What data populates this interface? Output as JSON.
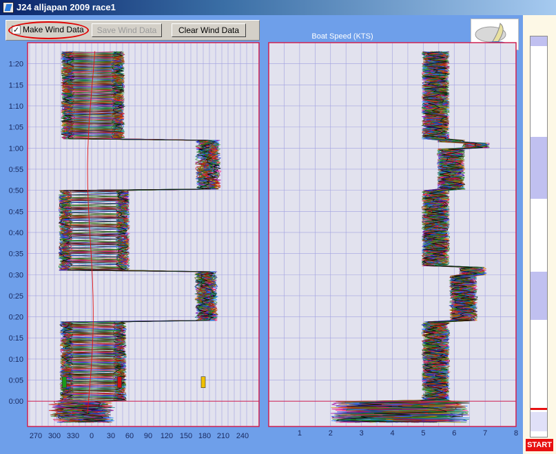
{
  "window": {
    "title": "J24  alljapan 2009 race1"
  },
  "toolbar": {
    "make_wind_label": "Make Wind Data",
    "make_wind_checked": "✓",
    "save_wind_label": "Save Wind Data",
    "clear_wind_label": "Clear Wind Data"
  },
  "colors": {
    "frame": "#6e9fea",
    "plot_bg": "#e2e2ee",
    "grid": "#a0a0e0",
    "axis_border": "#d02050",
    "start_red": "#e81010"
  },
  "sidebar": {
    "start_label": "START"
  },
  "chart_data": [
    {
      "type": "line",
      "title": "",
      "xlabel": "",
      "ylabel": "",
      "x_ticks": [
        "270",
        "300",
        "330",
        "0",
        "30",
        "60",
        "90",
        "120",
        "150",
        "180",
        "210",
        "240"
      ],
      "y_ticks": [
        "0:00",
        "0:05",
        "0:10",
        "0:15",
        "0:20",
        "0:25",
        "0:30",
        "0:35",
        "0:40",
        "0:45",
        "0:50",
        "0:55",
        "1:00",
        "1:05",
        "1:10",
        "1:15",
        "1:20"
      ],
      "xlim": [
        255,
        255
      ],
      "ylim_minutes": [
        -6,
        85
      ],
      "series_count": 40,
      "marks": [
        {
          "heading": 316,
          "minute": 4.5,
          "color": "#1a9a1a"
        },
        {
          "heading": 45,
          "minute": 4.5,
          "color": "#d01010"
        },
        {
          "heading": 180,
          "minute": 4.5,
          "color": "#f0c000"
        }
      ]
    },
    {
      "type": "line",
      "title": "Boat Speed (KTS)",
      "xlabel": "",
      "ylabel": "",
      "x_ticks": [
        "1",
        "2",
        "3",
        "4",
        "5",
        "6",
        "7",
        "8"
      ],
      "xlim": [
        0,
        8
      ],
      "ylim_minutes": [
        -6,
        85
      ],
      "series_count": 40
    }
  ]
}
